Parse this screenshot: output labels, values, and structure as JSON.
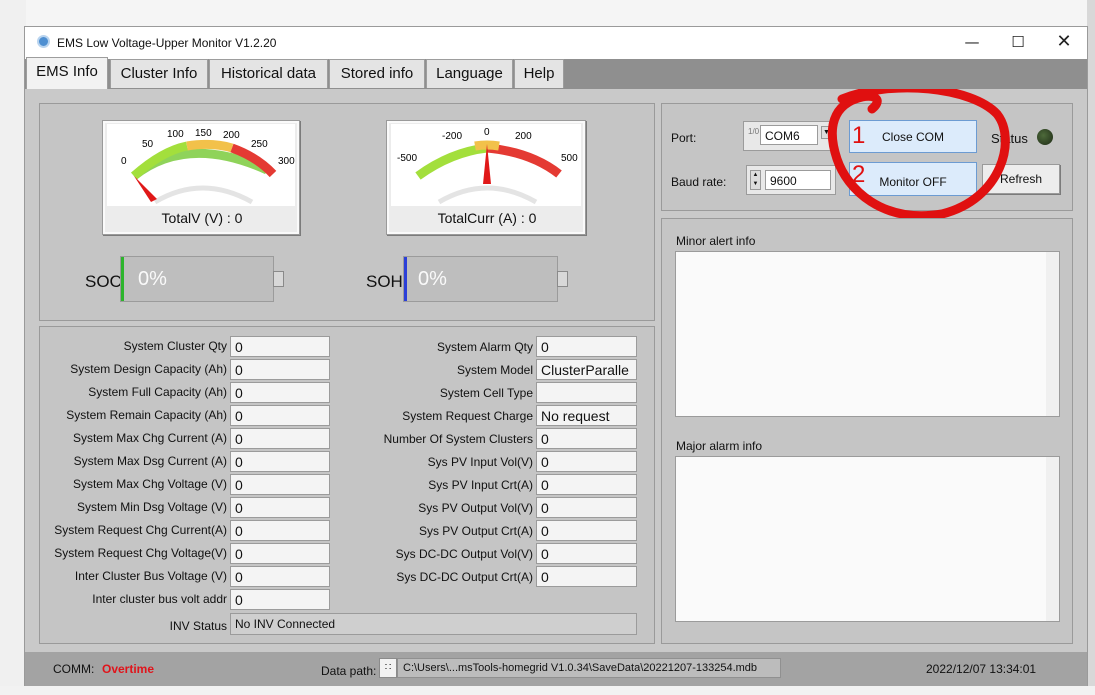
{
  "window": {
    "title": "EMS Low Voltage-Upper Monitor V1.2.20",
    "minimize_icon": "minimize-icon",
    "maximize_icon": "maximize-icon",
    "close_icon": "close-icon"
  },
  "tabs": [
    {
      "label": "EMS Info",
      "active": true
    },
    {
      "label": "Cluster Info"
    },
    {
      "label": "Historical data"
    },
    {
      "label": "Stored info"
    },
    {
      "label": "Language"
    },
    {
      "label": "Help"
    }
  ],
  "gauges": {
    "voltage": {
      "ticks": [
        "0",
        "50",
        "100",
        "150",
        "200",
        "250",
        "300"
      ],
      "label": "TotalV (V) :",
      "value": "0"
    },
    "current": {
      "ticks": [
        "-500",
        "-200",
        "0",
        "200",
        "500"
      ],
      "label": "TotalCurr (A) :",
      "value": "0"
    }
  },
  "soc": {
    "label": "SOC",
    "value": "0%",
    "fraction": 0,
    "color": "#2db52d"
  },
  "soh": {
    "label": "SOH",
    "value": "0%",
    "fraction": 0,
    "color": "#2b3fd8"
  },
  "system_left": [
    {
      "label": "System Cluster Qty",
      "value": "0"
    },
    {
      "label": "System Design Capacity (Ah)",
      "value": "0"
    },
    {
      "label": "System Full Capacity (Ah)",
      "value": "0"
    },
    {
      "label": "System Remain Capacity (Ah)",
      "value": "0"
    },
    {
      "label": "System Max Chg Current (A)",
      "value": "0"
    },
    {
      "label": "System Max Dsg Current (A)",
      "value": "0"
    },
    {
      "label": "System Max Chg Voltage (V)",
      "value": "0"
    },
    {
      "label": "System Min Dsg Voltage (V)",
      "value": "0"
    },
    {
      "label": "System Request Chg Current(A)",
      "value": "0"
    },
    {
      "label": "System Request Chg Voltage(V)",
      "value": "0"
    },
    {
      "label": "Inter Cluster Bus Voltage  (V)",
      "value": "0"
    },
    {
      "label": "Inter cluster bus volt addr",
      "value": "0"
    }
  ],
  "system_right": [
    {
      "label": "System Alarm Qty",
      "value": "0"
    },
    {
      "label": "System Model",
      "value": "ClusterParalle"
    },
    {
      "label": "System Cell Type",
      "value": ""
    },
    {
      "label": "System Request Charge",
      "value": "No request"
    },
    {
      "label": "Number Of System Clusters",
      "value": "0"
    },
    {
      "label": "Sys PV Input Vol(V)",
      "value": "0"
    },
    {
      "label": "Sys PV Input Crt(A)",
      "value": "0"
    },
    {
      "label": "Sys PV Output Vol(V)",
      "value": "0"
    },
    {
      "label": "Sys PV Output Crt(A)",
      "value": "0"
    },
    {
      "label": "Sys DC-DC Output Vol(V)",
      "value": "0"
    },
    {
      "label": "Sys DC-DC Output Crt(A)",
      "value": "0"
    }
  ],
  "inv_status": {
    "label": "INV Status",
    "value": "No INV Connected"
  },
  "connection": {
    "port_label": "Port:",
    "port_value": "COM6",
    "port_spinner_text": "1/0",
    "baud_label": "Baud rate:",
    "baud_value": "9600",
    "close_com_label": "Close COM",
    "monitor_label": "Monitor OFF",
    "status_label": "Status",
    "refresh_label": "Refresh",
    "annotation_1": "1",
    "annotation_2": "2",
    "annotation_color": "#e01010"
  },
  "alerts": {
    "minor_label": "Minor alert info",
    "major_label": "Major alarm info"
  },
  "statusbar": {
    "comm_label": "COMM:",
    "comm_value": "Overtime",
    "comm_color": "#e0141b",
    "data_path_label": "Data path:",
    "data_path_value": "C:\\Users\\...msTools-homegrid V1.0.34\\SaveData\\20221207-133254.mdb",
    "datetime": "2022/12/07 13:34:01"
  }
}
